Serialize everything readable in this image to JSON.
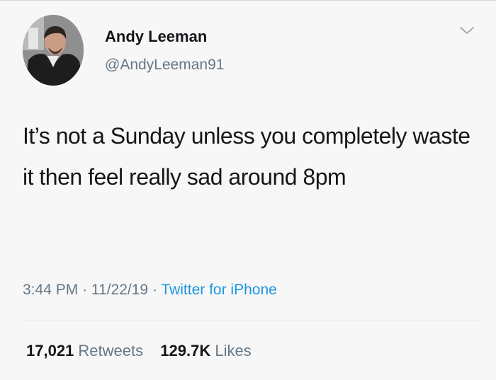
{
  "tweet": {
    "author": {
      "name": "Andy Leeman",
      "handle": "@AndyLeeman91"
    },
    "text": "It’s not a Sunday unless you completely waste it then feel really sad around 8pm",
    "time": "3:44 PM",
    "date": "11/22/19",
    "separator": "·",
    "source": "Twitter for iPhone",
    "stats": {
      "retweets_count": "17,021",
      "retweets_label": "Retweets",
      "likes_count": "129.7K",
      "likes_label": "Likes"
    }
  },
  "icons": {
    "menu": "chevron-down-icon",
    "avatar": "profile-photo"
  },
  "colors": {
    "text_primary": "#14171a",
    "text_secondary": "#657786",
    "link": "#1b95e0"
  }
}
